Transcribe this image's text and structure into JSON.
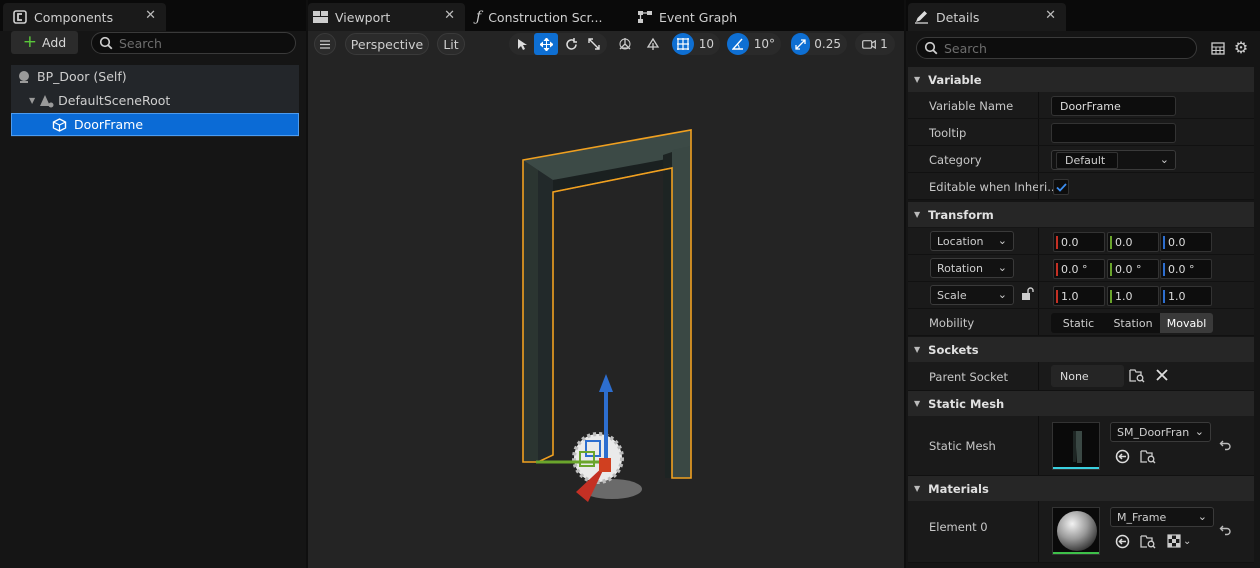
{
  "components": {
    "tab_label": "Components",
    "add_label": "Add",
    "search_placeholder": "Search",
    "tree": [
      "BP_Door (Self)",
      "DefaultSceneRoot",
      "DoorFrame"
    ]
  },
  "center_tabs": [
    "Viewport",
    "Construction Scr...",
    "Event Graph"
  ],
  "viewport_toolbar": {
    "perspective": "Perspective",
    "lit": "Lit",
    "grid_snap": "10",
    "rotation_snap": "10°",
    "scale_snap": "0.25",
    "camera_speed": "1"
  },
  "details": {
    "tab_label": "Details",
    "search_placeholder": "Search",
    "variable": {
      "header": "Variable",
      "name_label": "Variable Name",
      "name_value": "DoorFrame",
      "tooltip_label": "Tooltip",
      "tooltip_value": "",
      "category_label": "Category",
      "category_value": "Default",
      "editable_label": "Editable when Inheri...",
      "editable_checked": true
    },
    "transform": {
      "header": "Transform",
      "location_label": "Location",
      "location": [
        "0.0",
        "0.0",
        "0.0"
      ],
      "rotation_label": "Rotation",
      "rotation": [
        "0.0 °",
        "0.0 °",
        "0.0 °"
      ],
      "scale_label": "Scale",
      "scale": [
        "1.0",
        "1.0",
        "1.0"
      ],
      "mobility_label": "Mobility",
      "mobility_options": [
        "Static",
        "Station",
        "Movabl"
      ],
      "mobility_selected": "Movabl"
    },
    "sockets": {
      "header": "Sockets",
      "parent_socket_label": "Parent Socket",
      "parent_socket_value": "None"
    },
    "static_mesh": {
      "header": "Static Mesh",
      "label": "Static Mesh",
      "value": "SM_DoorFran"
    },
    "materials": {
      "header": "Materials",
      "element_label": "Element 0",
      "value": "M_Frame"
    }
  },
  "colors": {
    "accent": "#0e6fd3",
    "selection": "#0b6bd6",
    "outline": "#f0a020",
    "axis_x": "#c43024",
    "axis_y": "#6aa52c",
    "axis_z": "#2d6ecf"
  }
}
